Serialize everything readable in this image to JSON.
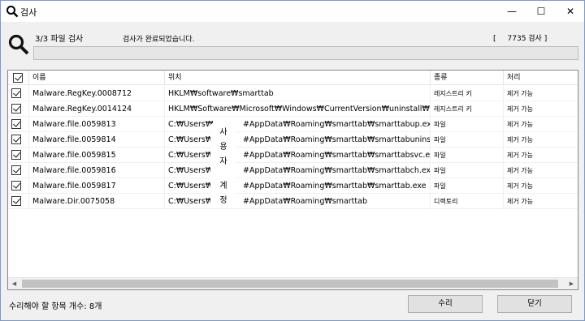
{
  "window": {
    "title": "검사",
    "minimize": "—",
    "maximize": "☐",
    "close": "✕"
  },
  "progress": {
    "label": "3/3 파일 검사",
    "status": "검사가 완료되었습니다.",
    "count_open": "[",
    "count_value": "7735 검사 ]",
    "fill_fraction": 0.0
  },
  "columns": {
    "name": "이름",
    "location": "위치",
    "type": "종류",
    "action": "처리"
  },
  "rows": [
    {
      "name": "Malware.RegKey.0008712",
      "location": "HKLM₩software₩smarttab",
      "type": "레지스트리 키",
      "action": "제거 가능"
    },
    {
      "name": "Malware.RegKey.0014124",
      "location": "HKLM₩Software₩Microsoft₩Windows₩CurrentVersion₩uninstall₩스마트탭",
      "type": "레지스트리 키",
      "action": "제거 가능"
    },
    {
      "name": "Malware.file.0059813",
      "location_pre": "C:₩Users₩",
      "location_post": "#AppData₩Roaming₩smarttab₩smarttabup.exe",
      "type": "파일",
      "action": "제거 가능"
    },
    {
      "name": "Malware.file.0059814",
      "location_pre": "C:₩Users₩",
      "location_post": "#AppData₩Roaming₩smarttab₩smarttabuninstall.e",
      "type": "파일",
      "action": "제거 가능"
    },
    {
      "name": "Malware.file.0059815",
      "location_pre": "C:₩Users₩",
      "location_post": "#AppData₩Roaming₩smarttab₩smarttabsvc.exe",
      "type": "파일",
      "action": "제거 가능"
    },
    {
      "name": "Malware.file.0059816",
      "location_pre": "C:₩Users₩",
      "location_post": "#AppData₩Roaming₩smarttab₩smarttabch.exe",
      "type": "파일",
      "action": "제거 가능"
    },
    {
      "name": "Malware.file.0059817",
      "location_pre": "C:₩Users₩",
      "location_post": "#AppData₩Roaming₩smarttab₩smarttab.exe",
      "type": "파일",
      "action": "제거 가능"
    },
    {
      "name": "Malware.Dir.0075058",
      "location_pre": "C:₩Users₩",
      "location_post": "#AppData₩Roaming₩smarttab",
      "type": "디렉토리",
      "action": "제거 가능"
    }
  ],
  "user_overlay": [
    "사",
    "용",
    "자",
    "계",
    "정"
  ],
  "footer": {
    "count_text": "수리해야 할 항목 개수: 8개",
    "repair_button": "수리",
    "close_button": "닫기"
  },
  "scroll": {
    "left": "◀",
    "right": "▶"
  },
  "colors": {
    "progress_track": "#e6e6e6",
    "border": "#828790"
  }
}
